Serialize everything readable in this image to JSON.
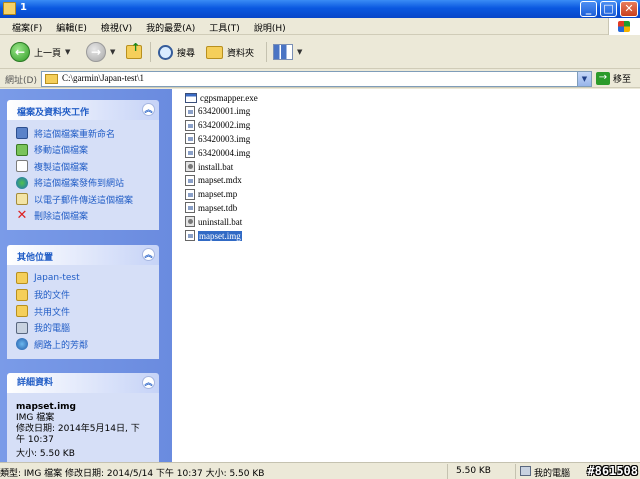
{
  "window": {
    "title": "1"
  },
  "controls": {
    "minimize": "_",
    "maximize": "□",
    "close": "✕"
  },
  "menu": [
    "檔案(F)",
    "編輯(E)",
    "檢視(V)",
    "我的最愛(A)",
    "工具(T)",
    "說明(H)"
  ],
  "toolbar": {
    "back_label": "上一頁",
    "search_label": "搜尋",
    "folders_label": "資料夾"
  },
  "address": {
    "label": "網址(D)",
    "path": "C:\\garmin\\Japan-test\\1",
    "go_label": "移至"
  },
  "tasks": {
    "file_folder": {
      "title": "檔案及資料夾工作",
      "items": [
        {
          "label": "將這個檔案重新命名",
          "icon": "rename-icon"
        },
        {
          "label": "移動這個檔案",
          "icon": "move-icon"
        },
        {
          "label": "複製這個檔案",
          "icon": "copy-icon"
        },
        {
          "label": "將這個檔案發佈到網站",
          "icon": "web-publish-icon"
        },
        {
          "label": "以電子郵件傳送這個檔案",
          "icon": "email-icon"
        },
        {
          "label": "刪除這個檔案",
          "icon": "delete-icon"
        }
      ]
    },
    "other_places": {
      "title": "其他位置",
      "items": [
        {
          "label": "Japan-test",
          "icon": "folder-icon"
        },
        {
          "label": "我的文件",
          "icon": "folder-icon"
        },
        {
          "label": "共用文件",
          "icon": "folder-icon"
        },
        {
          "label": "我的電腦",
          "icon": "computer-icon"
        },
        {
          "label": "網路上的芳鄰",
          "icon": "network-icon"
        }
      ]
    },
    "details": {
      "title": "詳細資料",
      "file_name": "mapset.img",
      "file_type": "IMG 檔案",
      "modified_line1": "修改日期: 2014年5月14日, 下",
      "modified_line2": "午 10:37",
      "size": "大小: 5.50 KB"
    }
  },
  "files": [
    {
      "name": "cgpsmapper.exe",
      "type": "exe",
      "selected": false
    },
    {
      "name": "63420001.img",
      "type": "img",
      "selected": false
    },
    {
      "name": "63420002.img",
      "type": "img",
      "selected": false
    },
    {
      "name": "63420003.img",
      "type": "img",
      "selected": false
    },
    {
      "name": "63420004.img",
      "type": "img",
      "selected": false
    },
    {
      "name": "install.bat",
      "type": "bat",
      "selected": false
    },
    {
      "name": "mapset.mdx",
      "type": "img",
      "selected": false
    },
    {
      "name": "mapset.mp",
      "type": "img",
      "selected": false
    },
    {
      "name": "mapset.tdb",
      "type": "img",
      "selected": false
    },
    {
      "name": "uninstall.bat",
      "type": "bat",
      "selected": false
    },
    {
      "name": "mapset.img",
      "type": "img",
      "selected": true
    }
  ],
  "status": {
    "info": "類型: IMG 檔案 修改日期: 2014/5/14 下午 10:37 大小: 5.50 KB",
    "size": "5.50 KB",
    "location": "我的電腦",
    "watermark": "#861508"
  },
  "colors": {
    "titlebar": "#0a58e0",
    "selection": "#316ac5",
    "task_link": "#215dc6",
    "task_pane": "#7a9be8"
  }
}
